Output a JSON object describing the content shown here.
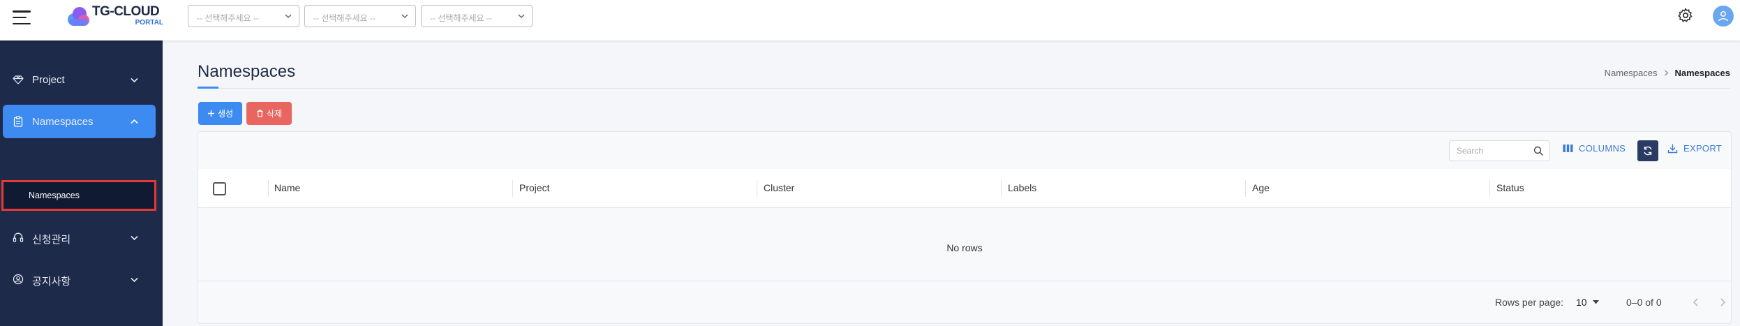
{
  "brand": {
    "title": "TG-CLOUD",
    "sub": "PORTAL"
  },
  "topbar": {
    "selects": [
      {
        "placeholder": "-- 선택해주세요 --"
      },
      {
        "placeholder": "-- 선택해주세요 --"
      },
      {
        "placeholder": "-- 선택해주세요 --"
      }
    ]
  },
  "sidebar": {
    "items": [
      {
        "label": "Project",
        "icon": "gem-icon"
      },
      {
        "label": "Namespaces",
        "icon": "clipboard-icon",
        "active": true
      },
      {
        "label": "신청관리",
        "icon": "headset-icon"
      },
      {
        "label": "공지사항",
        "icon": "user-circle-icon"
      }
    ],
    "sub_item": {
      "label": "Namespaces"
    }
  },
  "page": {
    "title": "Namespaces",
    "breadcrumb": [
      "Namespaces",
      "Namespaces"
    ]
  },
  "actions": {
    "create": "생성",
    "delete": "삭제"
  },
  "grid": {
    "search_placeholder": "Search",
    "columns_label": "COLUMNS",
    "export_label": "EXPORT",
    "columns": [
      "Name",
      "Project",
      "Cluster",
      "Labels",
      "Age",
      "Status"
    ],
    "empty_text": "No rows",
    "rows_per_page_label": "Rows per page:",
    "rows_per_page": "10",
    "range": "0–0 of 0"
  },
  "colors": {
    "sidebar_bg": "#1e2a4a",
    "accent": "#3d8bf0",
    "danger": "#e8665f",
    "highlight_border": "#e53935"
  }
}
